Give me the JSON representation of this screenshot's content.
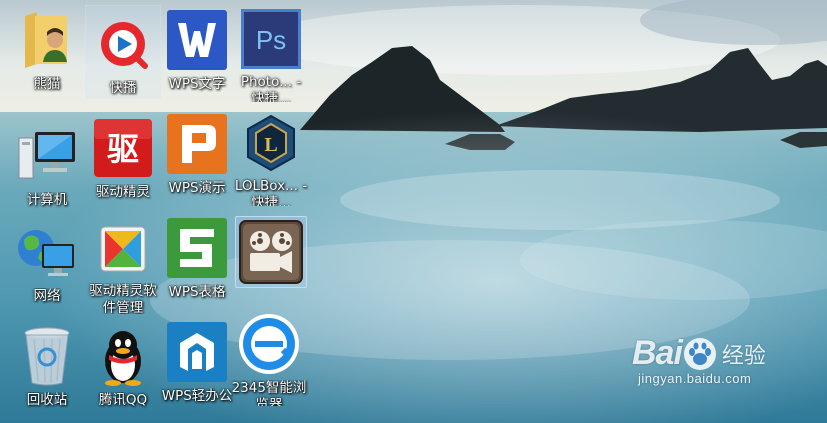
{
  "desktop": {
    "icons": [
      {
        "label": "熊猫",
        "icon": "user-folder-icon"
      },
      {
        "label": "计算机",
        "icon": "computer-icon"
      },
      {
        "label": "网络",
        "icon": "network-icon"
      },
      {
        "label": "回收站",
        "icon": "recycle-bin-icon"
      },
      {
        "label": "快播",
        "icon": "qvod-player-icon"
      },
      {
        "label": "驱动精灵",
        "icon": "driver-genius-icon"
      },
      {
        "label": "驱动精灵软件管理",
        "icon": "driver-genius-software-icon"
      },
      {
        "label": "腾讯QQ",
        "icon": "qq-penguin-icon"
      },
      {
        "label": "WPS文字",
        "icon": "wps-writer-icon"
      },
      {
        "label": "WPS演示",
        "icon": "wps-presentation-icon"
      },
      {
        "label": "WPS表格",
        "icon": "wps-spreadsheet-icon"
      },
      {
        "label": "WPS轻办公",
        "icon": "wps-light-office-icon"
      },
      {
        "label": "Photo... - 快捷...",
        "icon": "photoshop-icon"
      },
      {
        "label": "LOLBox... - 快捷...",
        "icon": "lolbox-icon"
      },
      {
        "label": "",
        "icon": "film-projector-icon"
      },
      {
        "label": "2345智能浏览器",
        "icon": "browser-2345-icon"
      }
    ]
  },
  "watermark": {
    "bai": "Bai",
    "du": "du",
    "cn": "经验",
    "url": "jingyan.baidu.com"
  },
  "colors": {
    "sky_top": "#d9e4e8",
    "sea": "#5fa3b6",
    "wps_writer": "#2b58c4",
    "wps_presentation": "#e8731f",
    "wps_spreadsheet": "#3c9a3c",
    "wps_light": "#1b7fc4",
    "photoshop": "#2b3a78",
    "driver_genius": "#d21c1c"
  }
}
